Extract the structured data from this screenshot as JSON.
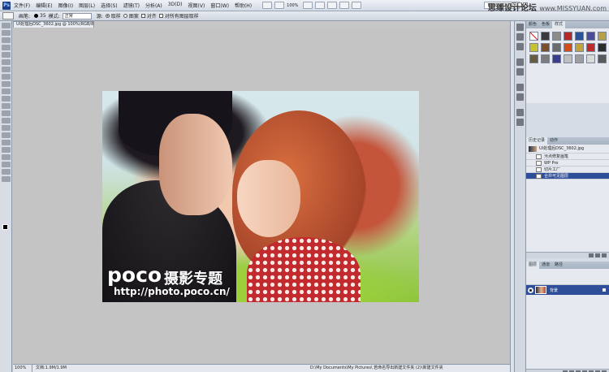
{
  "menubar": {
    "logo": "Ps",
    "items": [
      "文件(F)",
      "编辑(E)",
      "图像(I)",
      "图层(L)",
      "选择(S)",
      "滤镜(T)",
      "分析(A)",
      "3D(D)",
      "视图(V)",
      "窗口(W)",
      "帮助(H)"
    ],
    "zoom": "100%",
    "workspace": "ESSENTIALS ▾",
    "watermark": "思缘设计论坛",
    "watermark_url": "www.MISSYUAN.com"
  },
  "options": {
    "brush_label": "画笔:",
    "brush_size": "35",
    "mode_label": "模式:",
    "mode_value": "正常",
    "source_label": "源:",
    "sampled": "取样",
    "pattern": "图案",
    "aligned": "对齐",
    "all_layers": "对所有图层取样"
  },
  "document": {
    "tab_title": "UI处理后DSC_3602.jpg @ 100%(RGB/8)",
    "watermark_latin": "poco",
    "watermark_cn": "摄影专题",
    "watermark_url": "http://photo.poco.cn/"
  },
  "status": {
    "zoom": "100%",
    "doc_size": "文档:1.9M/1.9M",
    "path": "D:\\My Documents\\My Pictures\\ 若命名导出新建文件夹 (2)\\新建文件夹"
  },
  "panels": {
    "styles_tabs": [
      "颜色",
      "色板",
      "样式"
    ],
    "history_tabs": [
      "历史记录",
      "动作"
    ],
    "layers_tabs": [
      "图层",
      "通道",
      "路径"
    ],
    "history_items": [
      {
        "label": "UI处理后DSC_3602.jpg",
        "type": "snapshot"
      },
      {
        "label": "污点修复画笔",
        "type": "step"
      },
      {
        "label": "WP Pro",
        "type": "step"
      },
      {
        "label": "切片工厂",
        "type": "step"
      },
      {
        "label": "合并可见图层",
        "type": "step",
        "selected": true
      }
    ],
    "layer_name": "背景",
    "style_colors": [
      "#e11d1d",
      "#3a3a3a",
      "#8b8b8b",
      "#b52929",
      "#28539c",
      "#4c4c9a",
      "#b8a04b",
      "#c9c12a",
      "#7a4f2a",
      "#6b6b6b",
      "#d44c19",
      "#c2a23d",
      "#bf2b2b",
      "#2c2c2c",
      "#6a5a3e",
      "#7c7c7c",
      "#3b3b8f",
      "#bfbfbf",
      "#9e9e9e",
      "#d9d9d9",
      "#5a5a5a"
    ]
  }
}
